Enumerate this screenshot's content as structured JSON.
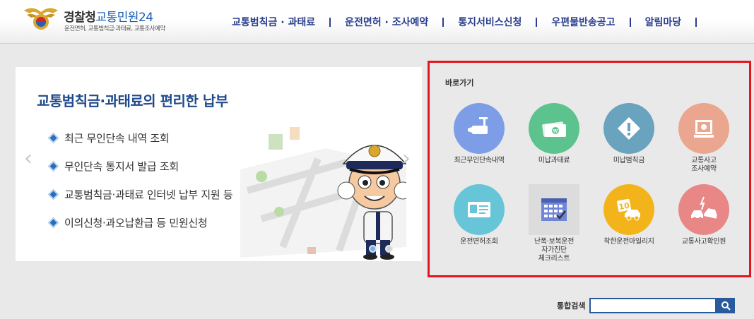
{
  "header": {
    "logo_main": "경찰청",
    "logo_service": "교통민원24",
    "logo_sub": "운전면허, 교통범칙금·과태료, 교통조사예약",
    "nav": [
      "교통범칙금 · 과태료",
      "운전면허 · 조사예약",
      "통지서비스신청",
      "우편물반송공고",
      "알림마당"
    ]
  },
  "banner": {
    "title": "교통범칙금·과태료의 편리한 납부",
    "items": [
      "최근 무인단속 내역 조회",
      "무인단속 통지서 발급 조회",
      "교통범칙금·과태료 인터넷 납부 지원 등",
      "이의신청·과오납환급 등 민원신청"
    ],
    "prev_arrow": "‹",
    "next_arrow": "›",
    "slides": 2,
    "active_slide": 1
  },
  "quick": {
    "title": "바로가기",
    "items": [
      {
        "label": "최근무인단속내역",
        "icon": "cctv-camera-icon",
        "color": "#7d9ee6"
      },
      {
        "label": "미납과태료",
        "icon": "money-bill-icon",
        "color": "#5cc38e"
      },
      {
        "label": "미납범칙금",
        "icon": "warning-diamond-icon",
        "color": "#6aa3be"
      },
      {
        "label": "교통사고\n조사예약",
        "icon": "computer-icon",
        "color": "#eaa68f"
      },
      {
        "label": "운전면허조회",
        "icon": "license-card-icon",
        "color": "#67c5d8"
      },
      {
        "label": "난폭·보복운전\n자가진단\n체크리스트",
        "icon": "checklist-calendar-icon",
        "color": "#6f86d8"
      },
      {
        "label": "착한운전마일리지",
        "icon": "mileage-10-icon",
        "color": "#f3b41b"
      },
      {
        "label": "교통사고확인원",
        "icon": "car-crash-icon",
        "color": "#e98686"
      }
    ]
  },
  "search": {
    "label": "통합검색",
    "value": "",
    "icon": "search-icon"
  }
}
